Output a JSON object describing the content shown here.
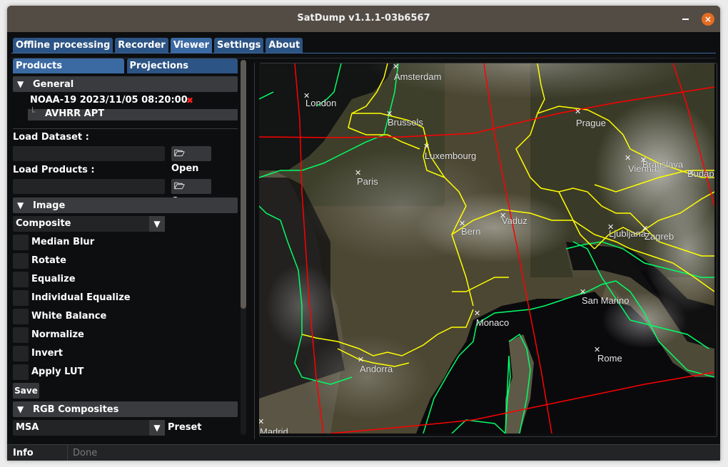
{
  "window": {
    "title": "SatDump v1.1.1-03b6567",
    "minimize_icon": "minimize-icon",
    "close_icon": "close-icon"
  },
  "tabs": [
    {
      "label": "Offline processing",
      "active": false
    },
    {
      "label": "Recorder",
      "active": false
    },
    {
      "label": "Viewer",
      "active": true
    },
    {
      "label": "Settings",
      "active": false
    },
    {
      "label": "About",
      "active": false
    }
  ],
  "left": {
    "subtabs": [
      {
        "label": "Products",
        "active": true
      },
      {
        "label": "Projections",
        "active": false
      }
    ],
    "general": {
      "header": "General",
      "dataset": "NOAA-19 2023/11/05 08:20:00",
      "remove_icon": "✖",
      "product": "AVHRR APT",
      "load_dataset_label": "Load Dataset :",
      "load_dataset_value": "",
      "load_products_label": "Load Products :",
      "load_products_value": "",
      "open_label": "Open",
      "folder_icon": "🗁"
    },
    "image": {
      "header": "Image",
      "mode": "Composite",
      "options": [
        {
          "label": "Median Blur",
          "checked": false
        },
        {
          "label": "Rotate",
          "checked": false
        },
        {
          "label": "Equalize",
          "checked": false
        },
        {
          "label": "Individual Equalize",
          "checked": false
        },
        {
          "label": "White Balance",
          "checked": false
        },
        {
          "label": "Normalize",
          "checked": false
        },
        {
          "label": "Invert",
          "checked": false
        },
        {
          "label": "Apply LUT",
          "checked": false
        }
      ],
      "save_label": "Save"
    },
    "rgb": {
      "header": "RGB Composites",
      "preset_value": "MSA",
      "preset_label": "Preset"
    },
    "scroll_position": 0
  },
  "map": {
    "cities": [
      {
        "name": "Amsterdam"
      },
      {
        "name": "London"
      },
      {
        "name": "Brussels"
      },
      {
        "name": "Prague"
      },
      {
        "name": "Luxembourg"
      },
      {
        "name": "Paris"
      },
      {
        "name": "Vienna"
      },
      {
        "name": "Bratislava"
      },
      {
        "name": "Budapest"
      },
      {
        "name": "Bern"
      },
      {
        "name": "Vaduz"
      },
      {
        "name": "Ljubljana"
      },
      {
        "name": "Zagreb"
      },
      {
        "name": "San Marino"
      },
      {
        "name": "Monaco"
      },
      {
        "name": "Rome"
      },
      {
        "name": "Andorra"
      },
      {
        "name": "Madrid"
      }
    ],
    "colors": {
      "grid": "#ff0000",
      "coast": "#00ff66",
      "borders": "#ffff00",
      "land": "#4a4430",
      "sea": "#0a0a0e"
    }
  },
  "status": {
    "label": "Info",
    "text": "Done"
  }
}
